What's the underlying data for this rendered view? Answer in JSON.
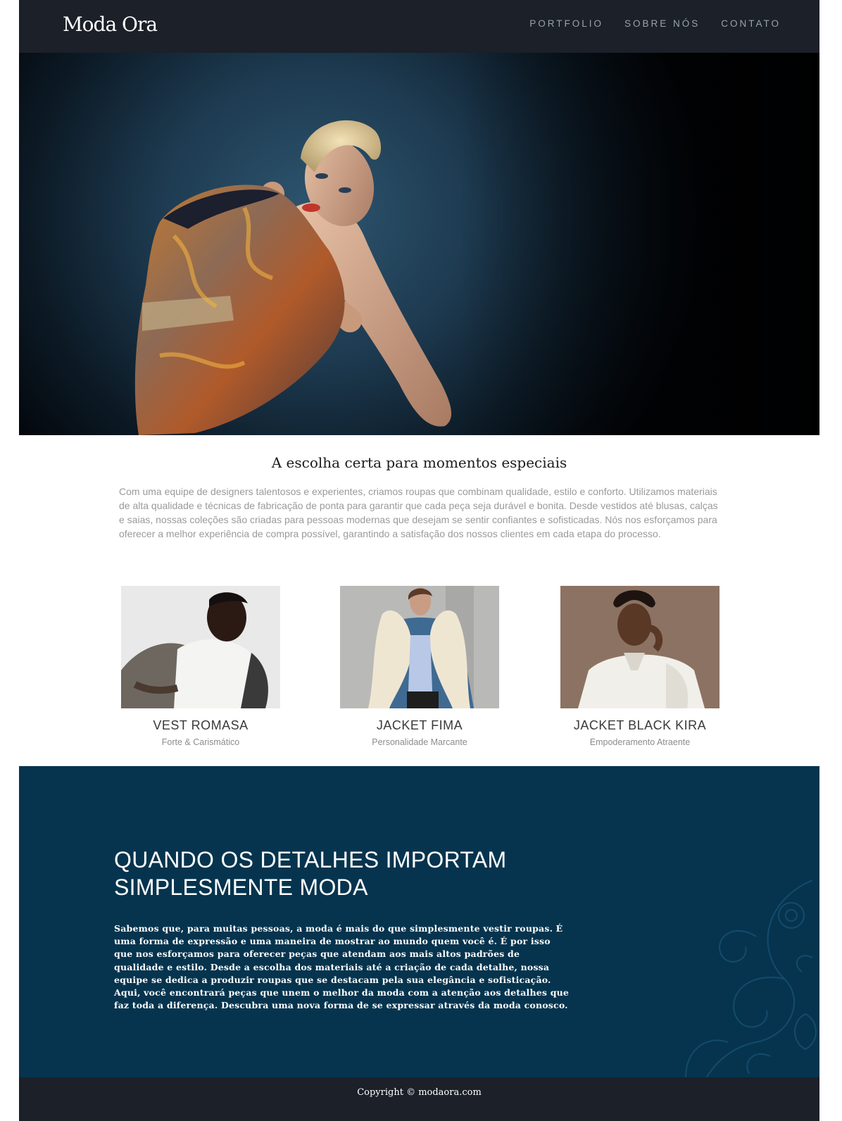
{
  "header": {
    "logo": "Moda Ora",
    "nav": [
      "PORTFOLIO",
      "SOBRE NÓS",
      "CONTATO"
    ]
  },
  "intro": {
    "title": "A escolha certa para momentos especiais",
    "text": "Com uma equipe de designers talentosos e experientes, criamos roupas que combinam qualidade, estilo e conforto. Utilizamos materiais de alta qualidade e técnicas de fabricação de ponta para garantir que cada peça seja durável e bonita. Desde vestidos até blusas, calças e saias, nossas coleções são criadas para pessoas modernas que desejam se sentir confiantes e sofisticadas. Nós nos esforçamos para oferecer a melhor experiência de compra possível, garantindo a satisfação dos nossos clientes em cada etapa do processo."
  },
  "products": [
    {
      "name": "VEST ROMASA",
      "tagline": "Forte & Carismático"
    },
    {
      "name": "JACKET FIMA",
      "tagline": "Personalidade Marcante"
    },
    {
      "name": "JACKET BLACK KIRA",
      "tagline": "Empoderamento Atraente"
    }
  ],
  "details": {
    "heading_line1": "QUANDO OS DETALHES IMPORTAM",
    "heading_line2": "SIMPLESMENTE MODA",
    "text": "Sabemos que, para muitas pessoas, a moda é mais do que simplesmente vestir roupas. É uma forma de expressão e uma maneira de mostrar ao mundo quem você é. É por isso que nos esforçamos para oferecer peças que atendam aos mais altos padrões de qualidade e estilo. Desde a escolha dos materiais até a criação de cada detalhe, nossa equipe se dedica a produzir roupas que se destacam pela sua elegância e sofisticação. Aqui, você encontrará peças que unem o melhor da moda com a atenção aos detalhes que faz toda a diferença. Descubra uma nova forma de se expressar através da moda conosco."
  },
  "footer": {
    "copyright": "Copyright © modaora.com"
  }
}
